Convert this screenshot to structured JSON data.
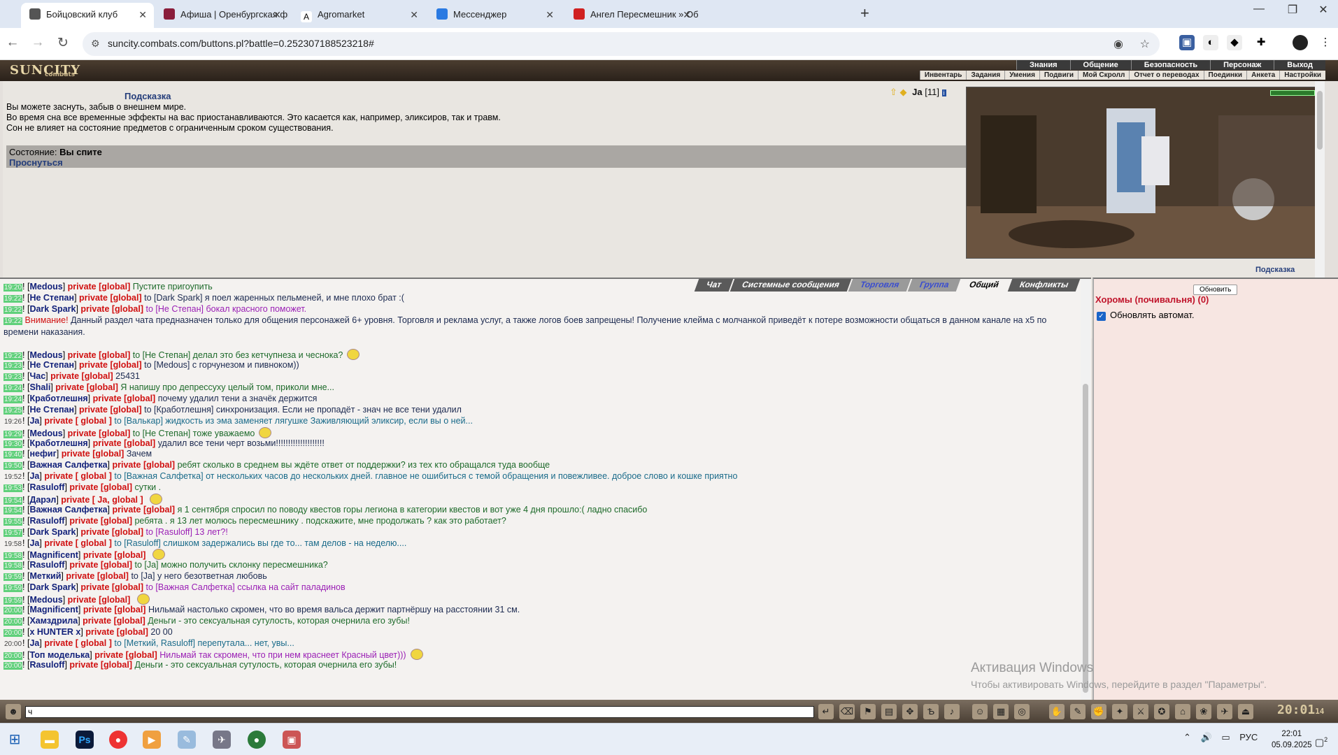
{
  "browser": {
    "tabs": [
      {
        "title": "Бойцовский клуб",
        "active": true,
        "favicon": "swords-icon"
      },
      {
        "title": "Афиша | Оренбургская филар...",
        "active": false,
        "favicon": "theater-icon"
      },
      {
        "title": "Agromarket",
        "active": false,
        "favicon": "a-logo-icon"
      },
      {
        "title": "Мессенджер",
        "active": false,
        "favicon": "chat-icon"
      },
      {
        "title": "Ангел Пересмешник » Общая...",
        "active": false,
        "favicon": "red-cross-icon"
      }
    ],
    "url": "suncity.combats.com/buttons.pl?battle=0.252307188523218#"
  },
  "site": {
    "logo": "SUNCITY",
    "logo_sub": "combats",
    "top_menu": [
      "Знания",
      "Общение",
      "Безопасность",
      "Персонаж",
      "Выход"
    ],
    "sub_menu": [
      "Инвентарь",
      "Задания",
      "Умения",
      "Подвиги",
      "Мой Скролл",
      "Отчет о переводах",
      "Поединки",
      "Анкета",
      "Настройки"
    ]
  },
  "hint": {
    "title": "Подсказка",
    "lines": [
      "Вы можете заснуть, забыв о внешнем мире.",
      "Во время сна все временные эффекты на вас приостанавливаются. Это касается как, например, эликсиров, так и травм.",
      "Сон не влияет на состояние предметов с ограниченным сроком существования."
    ],
    "state_label": "Состояние:",
    "state_value": "Вы спите",
    "wake_link": "Проснуться",
    "room_hint_link": "Подсказка"
  },
  "player": {
    "name": "Ja",
    "level": "[11]"
  },
  "chat": {
    "tabs": [
      "Чат",
      "Системные сообщения",
      "Торговля",
      "Группа",
      "Общий",
      "Конфликты"
    ],
    "active_tab": "Общий",
    "messages": [
      {
        "time": "19:20",
        "nick": "Medous",
        "chan": "private [global]",
        "text": "Пустите пригоупить",
        "cls": "tg"
      },
      {
        "time": "19:22",
        "nick": "Не Степан",
        "chan": "private [global]",
        "text": "to [Dark Spark] я поел жаренных пельменей, и мне плохо брат :(",
        "cls": "tx"
      },
      {
        "time": "19:22",
        "nick": "Dark Spark",
        "chan": "private [global]",
        "text": "to [Не Степан] бокал красного поможет.",
        "cls": "tp"
      },
      {
        "time": "19:22",
        "nick": "",
        "chan": "Внимание!",
        "text": "Данный раздел чата предназначен только для общения персонажей 6+ уровня. Торговля и реклама услуг, а также логов боев запрещены! Получение клейма с молчанкой приведёт к потере возможности общаться в данном канале на x5 по времени наказания.",
        "cls": "tx",
        "warn": true
      },
      {
        "time": "19:22",
        "nick": "Medous",
        "chan": "private [global]",
        "text": "to [Не Степан] делал это без кетчупнеза и чеснока?",
        "cls": "tg",
        "emo": true
      },
      {
        "time": "19:23",
        "nick": "Не Степан",
        "chan": "private [global]",
        "text": "to [Medous] с горчунезом и пивноком))",
        "cls": "tx"
      },
      {
        "time": "19:23",
        "nick": "Час",
        "chan": "private [global]",
        "text": "25431",
        "cls": "tx"
      },
      {
        "time": "19:24",
        "nick": "Shali",
        "chan": "private [global]",
        "text": "Я напишу про депрессуху целый том, приколи мне...",
        "cls": "tg"
      },
      {
        "time": "19:24",
        "nick": "Кработлешня",
        "chan": "private [global]",
        "text": "почему удалил тени а значёк держится",
        "cls": "tx"
      },
      {
        "time": "19:25",
        "nick": "Не Степан",
        "chan": "private [global]",
        "text": "to [Кработлешня] синхронизация. Если не пропадёт - знач не все тени удалил",
        "cls": "tx"
      },
      {
        "time": "19:26",
        "nick": "Ja",
        "chan": "private [ global ]",
        "text": "to [Валькар] жидкость из эма заменяет лягушке Заживляющий эликсир, если вы о ней...",
        "cls": "tt",
        "self": true
      },
      {
        "time": "19:29",
        "nick": "Medous",
        "chan": "private [global]",
        "text": "to [Не Степан] тоже уважаемо",
        "cls": "tg",
        "emo": true
      },
      {
        "time": "19:30",
        "nick": "Кработлешня",
        "chan": "private [global]",
        "text": "удалил все тени черт возьми!!!!!!!!!!!!!!!!!!!!",
        "cls": "tx"
      },
      {
        "time": "19:40",
        "nick": "нефиг",
        "chan": "private [global]",
        "text": "Зачем",
        "cls": "tx"
      },
      {
        "time": "19:50",
        "nick": "Важная Салфетка",
        "chan": "private [global]",
        "text": "ребят сколько в среднем вы ждёте ответ от поддержки? из тех кто обращался туда вообще",
        "cls": "tg"
      },
      {
        "time": "19:52",
        "nick": "Ja",
        "chan": "private [ global ]",
        "text": "to [Важная Салфетка] от нескольких часов до нескольких дней. главное не ошибиться с темой обращения и повежливее. доброе слово и кошке приятно",
        "cls": "tt",
        "self": true
      },
      {
        "time": "19:53",
        "nick": "Rasuloff",
        "chan": "private [global]",
        "text": "сутки .",
        "cls": "tg"
      },
      {
        "time": "19:54",
        "nick": "Дарэл",
        "chan": "private [ Ja, global ]",
        "text": "",
        "cls": "tx",
        "emo": true
      },
      {
        "time": "19:54",
        "nick": "Важная Салфетка",
        "chan": "private [global]",
        "text": "я 1 сентября спросил по поводу квестов горы легиона в категории квестов и вот уже 4 дня прошло:( ладно спасибо",
        "cls": "tg"
      },
      {
        "time": "19:55",
        "nick": "Rasuloff",
        "chan": "private [global]",
        "text": "ребята . я 13 лет молюсь пересмешнику . подскажите, мне продолжать ? как это работает?",
        "cls": "tg"
      },
      {
        "time": "19:57",
        "nick": "Dark Spark",
        "chan": "private [global]",
        "text": "to [Rasuloff] 13 лет?!",
        "cls": "tp"
      },
      {
        "time": "19:58",
        "nick": "Ja",
        "chan": "private [ global ]",
        "text": "to [Rasuloff] слишком задержались вы где то... там делов - на неделю....",
        "cls": "tt",
        "self": true
      },
      {
        "time": "19:58",
        "nick": "Magnificent",
        "chan": "private [global]",
        "text": "",
        "cls": "tx",
        "emo": true
      },
      {
        "time": "19:58",
        "nick": "Rasuloff",
        "chan": "private [global]",
        "text": "to [Ja] можно получить склонку пересмешника?",
        "cls": "tg"
      },
      {
        "time": "19:59",
        "nick": "Меткий",
        "chan": "private [global]",
        "text": "to [Ja] у него безответная любовь",
        "cls": "tx"
      },
      {
        "time": "19:59",
        "nick": "Dark Spark",
        "chan": "private [global]",
        "text": "to [Важная Салфетка] ссылка на сайт паладинов",
        "cls": "tp"
      },
      {
        "time": "19:59",
        "nick": "Medous",
        "chan": "private [global]",
        "text": "",
        "cls": "tg",
        "emo": true
      },
      {
        "time": "20:00",
        "nick": "Magnificent",
        "chan": "private [global]",
        "text": "Нильмай настолько скромен, что во время вальса держит партнёршу на расстоянии 31 см.",
        "cls": "tx"
      },
      {
        "time": "20:00",
        "nick": "Хамздрила",
        "chan": "private [global]",
        "text": "Деньги - это сексуальная сутулость, которая очернила его зубы!",
        "cls": "tg"
      },
      {
        "time": "20:00",
        "nick": "x HUNTER x",
        "chan": "private [global]",
        "text": "20 00",
        "cls": "tx"
      },
      {
        "time": "20:00",
        "nick": "Ja",
        "chan": "private [ global ]",
        "text": "to [Меткий, Rasuloff] перепутала... нет, увы...",
        "cls": "tt",
        "self": true
      },
      {
        "time": "20:00",
        "nick": "Топ моделька",
        "chan": "private [global]",
        "text": "Нильмай так скромен, что при нем краснеет Красный цвет)))",
        "cls": "tp",
        "emo": true
      },
      {
        "time": "20:00",
        "nick": "Rasuloff",
        "chan": "private [global]",
        "text": "Деньги - это сексуальная сутулость, которая очернила его зубы!",
        "cls": "tg"
      }
    ],
    "input_value": "ч"
  },
  "room": {
    "refresh_button": "Обновить",
    "name": "Хоромы (почивальня) (0)",
    "auto_update_label": "Обновлять автомат.",
    "auto_update_checked": true
  },
  "game_clock": "20:01",
  "game_clock_sec": "14",
  "watermark": {
    "line1": "Активация Windows",
    "line2": "Чтобы активировать Windows, перейдите в раздел \"Параметры\"."
  },
  "taskbar": {
    "lang": "РУС",
    "time": "22:01",
    "date": "05.09.2025",
    "notif_count": "2"
  },
  "colors": {
    "accent": "#243d7a",
    "private": "#d01010",
    "time_bg": "#5fd07a"
  }
}
